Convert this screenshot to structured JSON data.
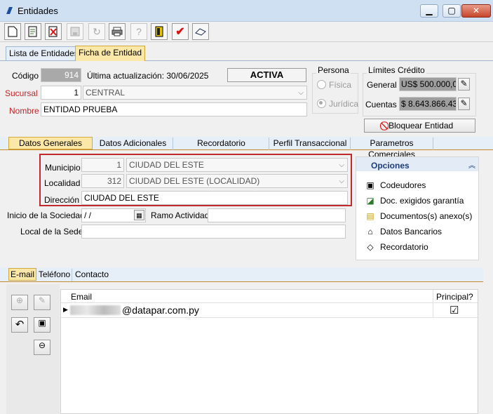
{
  "window": {
    "title": "Entidades",
    "min": "▁",
    "max": "▢",
    "close": "✕"
  },
  "toolbar": {
    "icons": [
      "new-doc-icon",
      "edit-doc-icon",
      "delete-icon",
      "save-icon",
      "refresh-icon",
      "print-icon",
      "help-icon",
      "exit-icon",
      "check-icon",
      "eraser-icon"
    ]
  },
  "main_tabs": [
    "Lista de Entidades",
    "Ficha de Entidad"
  ],
  "codigo": {
    "label": "Código",
    "value": "914"
  },
  "ultima": "Última actualización: 30/06/2025",
  "status": "ACTIVA",
  "sucursal": {
    "label": "Sucursal",
    "code": "1",
    "name": "CENTRAL"
  },
  "nombre": {
    "label": "Nombre",
    "value": "ENTIDAD PRUEBA"
  },
  "persona": {
    "title": "Persona",
    "fisica": "Física",
    "juridica": "Jurídica"
  },
  "limites": {
    "title": "Límites Crédito",
    "general_label": "General",
    "general_value": "US$ 500.000,00",
    "cuentas_label": "Cuentas",
    "cuentas_value": "$ 8.643.866.438"
  },
  "bloquear": "Bloquear Entidad",
  "inner_tabs": [
    "Datos Generales",
    "Datos Adicionales",
    "Recordatorio",
    "Perfil Transaccional",
    "Parametros Comerciales"
  ],
  "municipio": {
    "label": "Municipio",
    "code": "1",
    "name": "CIUDAD DEL ESTE"
  },
  "localidad": {
    "label": "Localidad",
    "code": "312",
    "name": "CIUDAD DEL ESTE (LOCALIDAD)"
  },
  "direccion": {
    "label": "Dirección",
    "value": "CIUDAD DEL ESTE"
  },
  "inicio": {
    "label": "Inicio de la Sociedad",
    "value": " /  /"
  },
  "ramo": {
    "label": "Ramo Actividad"
  },
  "local": {
    "label": "Local de la Sede"
  },
  "opciones": {
    "title": "Opciones",
    "items": [
      "Codeudores",
      "Doc. exigidos garantía",
      "Documentos(s) anexo(s)",
      "Datos Bancarios",
      "Recordatorio"
    ]
  },
  "contact_tabs": [
    "E-mail",
    "Teléfono",
    "Contacto"
  ],
  "email_grid": {
    "col_email": "Email",
    "col_principal": "Principal?",
    "row_email": "@datapar.com.py",
    "row_principal": "☑"
  }
}
